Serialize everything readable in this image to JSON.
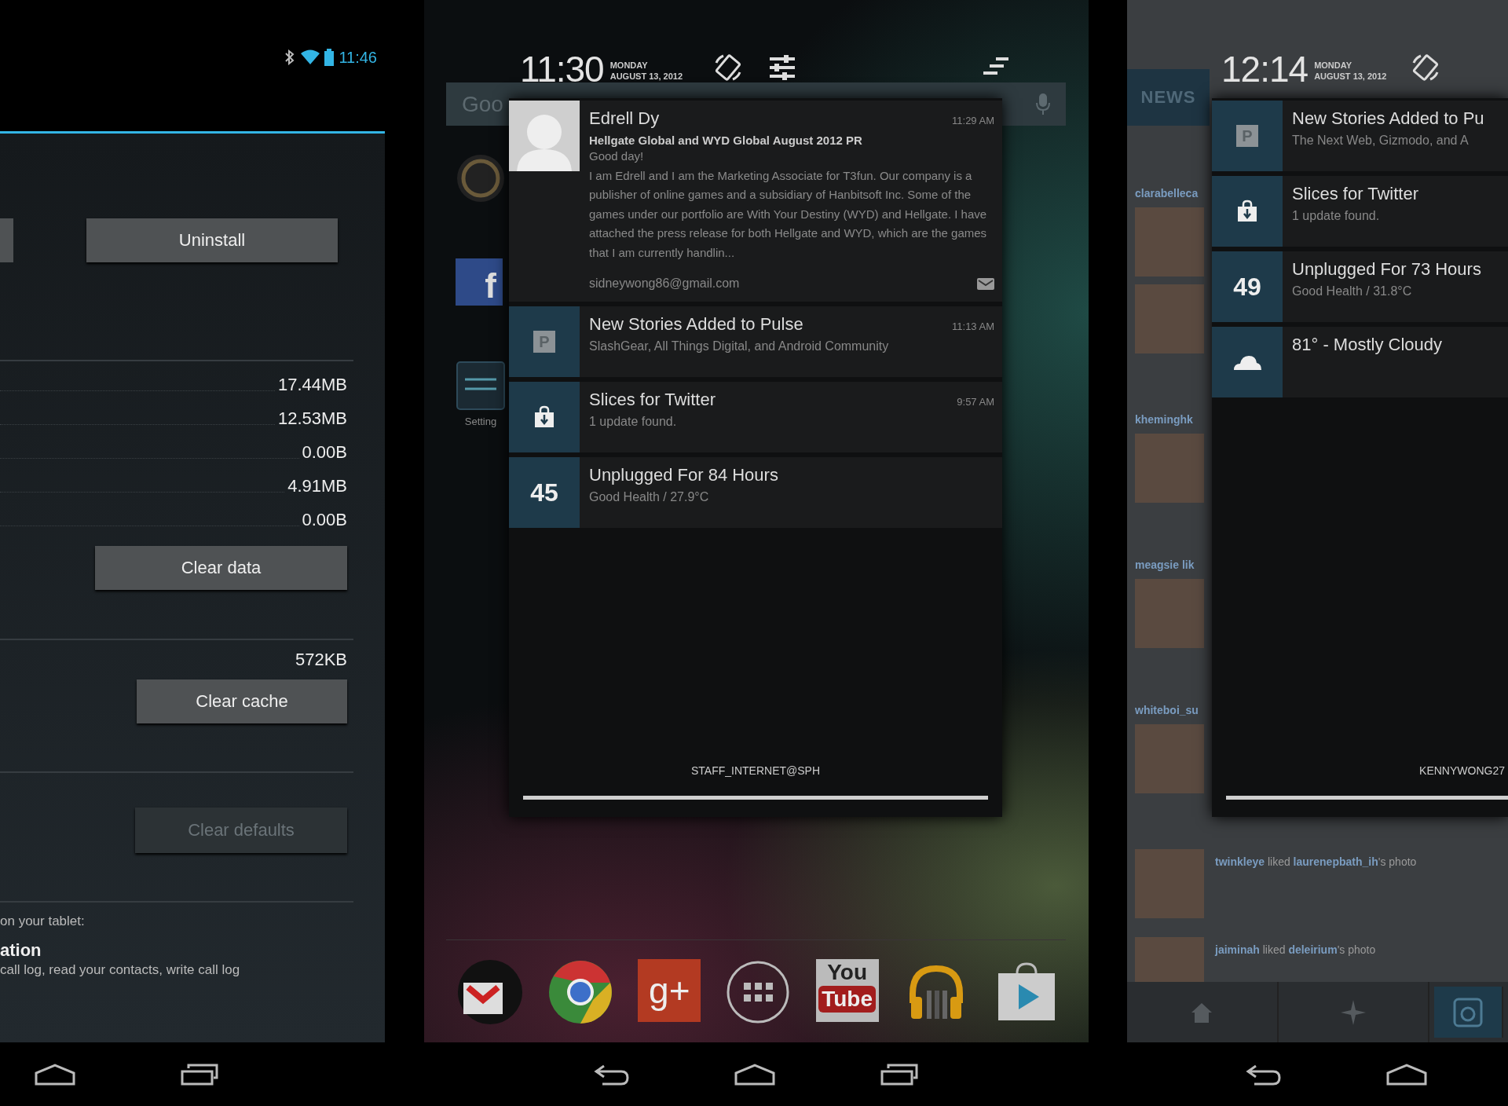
{
  "left_screen": {
    "status_time": "11:46",
    "action_button": {
      "label": "Uninstall",
      "disabled": false
    },
    "storage": {
      "values": [
        "17.44MB",
        "12.53MB",
        "0.00B",
        "4.91MB",
        "0.00B"
      ],
      "button": {
        "label": "Clear data",
        "disabled": false
      }
    },
    "cache": {
      "value": "572KB",
      "button": {
        "label": "Clear cache",
        "disabled": false
      }
    },
    "defaults": {
      "button": {
        "label": "Clear defaults",
        "disabled": true
      }
    },
    "permissions": {
      "intro": "on your tablet:",
      "title": "ation",
      "detail": "call log, read your contacts, write call log"
    }
  },
  "middle_screen": {
    "clock": "11:30",
    "day": "MONDAY",
    "date": "AUGUST 13, 2012",
    "search_placeholder": "Goo",
    "home_icons": [
      {
        "kind": "round"
      },
      {
        "kind": "facebook",
        "text": "f"
      },
      {
        "kind": "settings",
        "label": "Setting"
      }
    ],
    "notifications": [
      {
        "kind": "email",
        "sender": "Edrell Dy",
        "time": "11:29 AM",
        "subject": "Hellgate Global and WYD Global August 2012 PR",
        "greeting": "Good day!",
        "body": "I am Edrell and I am the Marketing Associate for T3fun. Our company is a publisher of online games and a subsidiary of Hanbitsoft Inc. Some of the games under our portfolio are With Your Destiny (WYD) and Hellgate. I have attached the press release for both Hellgate and WYD, which are the games that I am currently handlin...",
        "account": "sidneywong86@gmail.com"
      },
      {
        "kind": "pulse",
        "badge": "P",
        "title": "New Stories Added to Pulse",
        "time": "11:13 AM",
        "text": "SlashGear, All Things Digital, and Android Community"
      },
      {
        "kind": "store",
        "title": "Slices for Twitter",
        "time": "9:57 AM",
        "text": "1 update found."
      },
      {
        "kind": "battery",
        "badge": "45",
        "title": "Unplugged For 84 Hours",
        "text": "Good Health / 27.9°C"
      }
    ],
    "footer": "STAFF_INTERNET@SPH",
    "dock": [
      {
        "kind": "gmail"
      },
      {
        "kind": "chrome"
      },
      {
        "kind": "gplus",
        "text": "g+"
      },
      {
        "kind": "apps"
      },
      {
        "kind": "youtube",
        "text": "You",
        "text2": "Tube"
      },
      {
        "kind": "music"
      },
      {
        "kind": "store"
      }
    ]
  },
  "right_screen": {
    "clock": "12:14",
    "day": "MONDAY",
    "date": "AUGUST 13, 2012",
    "header": "NEWS",
    "feed_users": [
      "clarabelleca",
      "kheminghk",
      "meagsie lik",
      "whiteboi_su"
    ],
    "feed_items": [
      "**twinkleye** liked **laurenepbath_ih**'s photo",
      "**jaiminah** liked **deleirium**'s photo"
    ],
    "notifications": [
      {
        "kind": "pulse",
        "badge": "P",
        "title": "New Stories Added to Pu",
        "text": "The Next Web, Gizmodo, and A"
      },
      {
        "kind": "store",
        "title": "Slices for Twitter",
        "text": "1 update found."
      },
      {
        "kind": "battery",
        "badge": "49",
        "title": "Unplugged For 73 Hours",
        "text": "Good Health / 31.8°C"
      },
      {
        "kind": "weather",
        "title": "81° - Mostly Cloudy"
      }
    ],
    "footer": "KENNYWONG27",
    "tabs": [
      {
        "selected": false
      },
      {
        "selected": false
      },
      {
        "selected": true
      }
    ]
  }
}
